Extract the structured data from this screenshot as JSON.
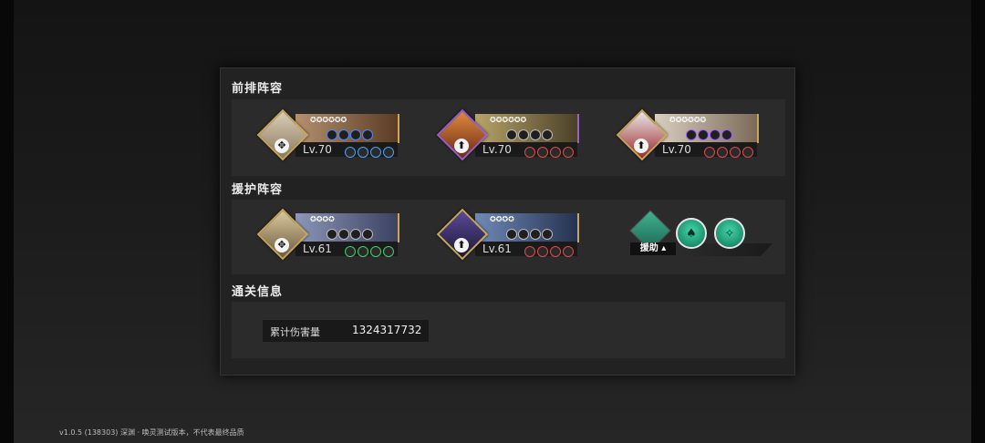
{
  "sections": {
    "front": {
      "title": "前排阵容",
      "characters": [
        {
          "level": "Lv.70",
          "stars": "✪✪✪✪✪✪",
          "frame_color": "#c9a65a",
          "portrait_colors": [
            "#d9cdb8",
            "#8d7a5d"
          ],
          "banner_colors": [
            "#b49070",
            "#5a3c24"
          ],
          "skill_color": "#4a88ff",
          "gear_color": "#4aa3ff",
          "class_icon": "arrows-cross-icon"
        },
        {
          "level": "Lv.70",
          "stars": "✪✪✪✪✪✪",
          "frame_color": "#9a5fc8",
          "portrait_colors": [
            "#e08a3c",
            "#6a2a16"
          ],
          "banner_colors": [
            "#b8a46a",
            "#4b4028"
          ],
          "skill_color": "#bdbdbd",
          "gear_color": "#e04a4a",
          "class_icon": "arrow-up-icon"
        },
        {
          "level": "Lv.70",
          "stars": "✪✪✪✪✪✪",
          "frame_color": "#c9a65a",
          "portrait_colors": [
            "#e8e8e8",
            "#9c2a2a"
          ],
          "banner_colors": [
            "#d9cfc0",
            "#7b6a58"
          ],
          "skill_color": "#9b5cff",
          "gear_color": "#e04a4a",
          "class_icon": "arrow-up-icon"
        }
      ]
    },
    "support": {
      "title": "援护阵容",
      "characters": [
        {
          "level": "Lv.61",
          "stars": "✪✪✪✪",
          "frame_color": "#c9a65a",
          "portrait_colors": [
            "#d8c8a0",
            "#6f5a3a"
          ],
          "banner_colors": [
            "#8c96b8",
            "#3c4260"
          ],
          "skill_color": "#bdbdbd",
          "gear_color": "#3fd070",
          "class_icon": "arrows-cross-icon"
        },
        {
          "level": "Lv.61",
          "stars": "✪✪✪✪",
          "frame_color": "#c9a65a",
          "portrait_colors": [
            "#5a4a9a",
            "#1d1733"
          ],
          "banner_colors": [
            "#6f8ab8",
            "#26324f"
          ],
          "skill_color": "#bdbdbd",
          "gear_color": "#e04a4a",
          "class_icon": "arrow-up-icon"
        }
      ],
      "assist": {
        "label": "援助",
        "skills": [
          "drops-icon",
          "swirl-icon"
        ]
      }
    },
    "clear_info": {
      "title": "通关信息",
      "stat_label": "累计伤害量",
      "stat_value": "1324317732"
    }
  },
  "footer": {
    "version": "v1.0.5 (138303) 深渊 · 唤灵测试版本，不代表最终品质"
  }
}
